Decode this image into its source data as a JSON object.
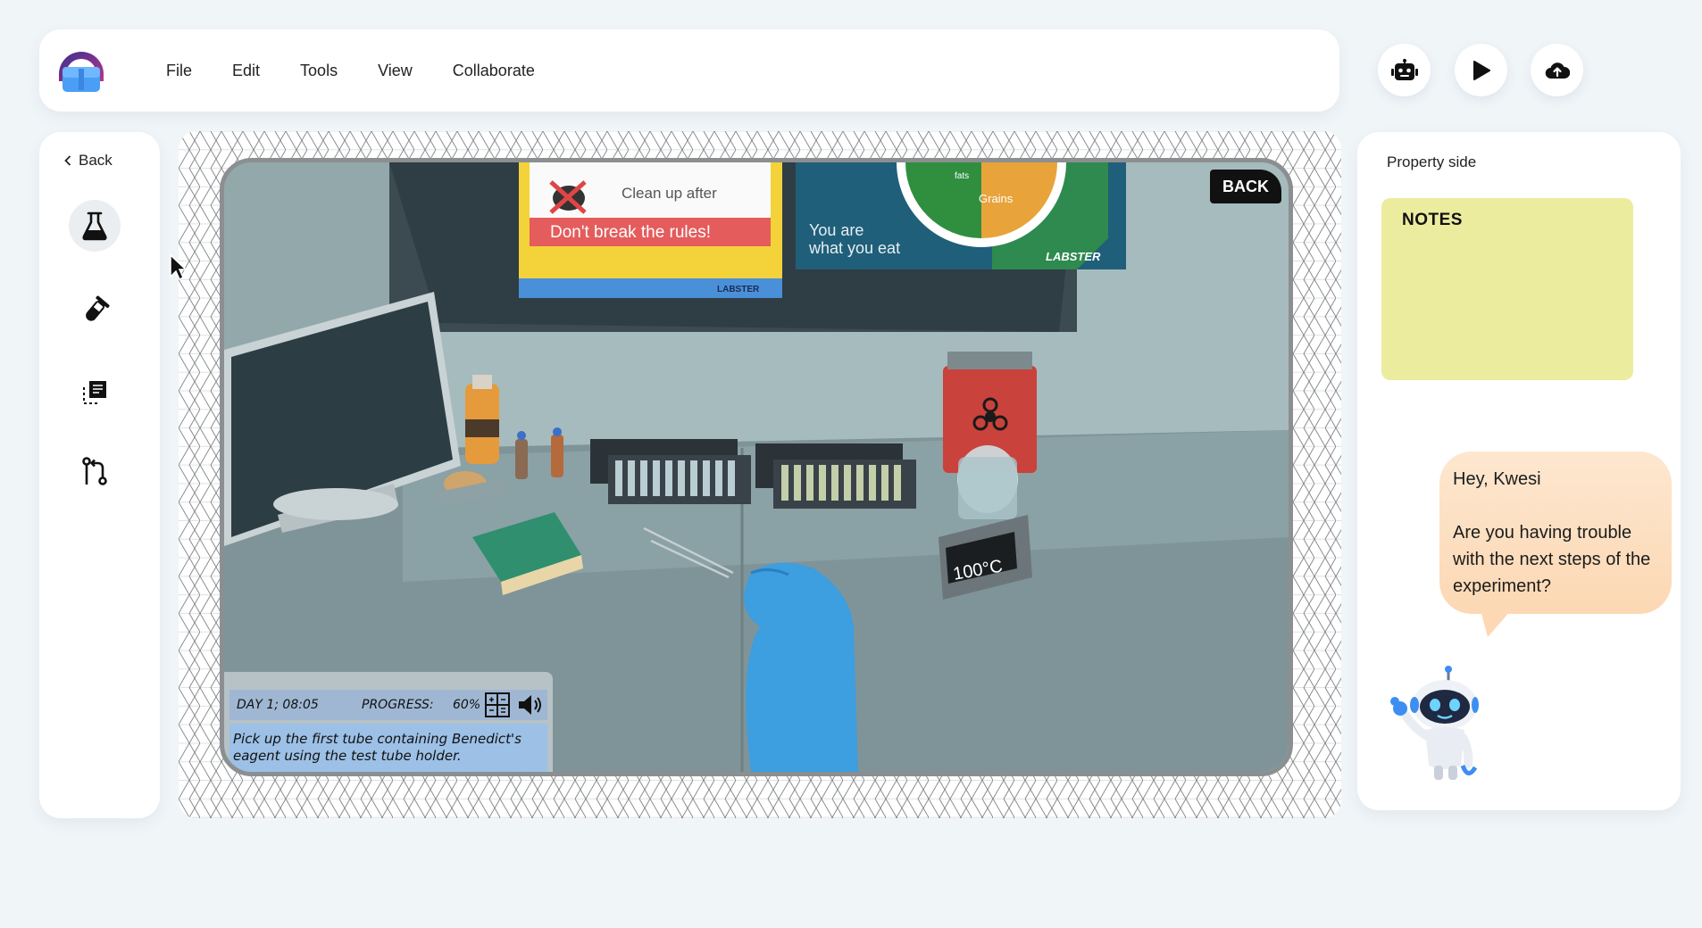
{
  "menubar": {
    "items": [
      "File",
      "Edit",
      "Tools",
      "View",
      "Collaborate"
    ]
  },
  "actions": {
    "assistant_icon": "robot-icon",
    "play_icon": "play-icon",
    "upload_icon": "cloud-upload-icon"
  },
  "sidebar": {
    "back_label": "Back",
    "tools": [
      {
        "icon": "flask-icon",
        "active": true
      },
      {
        "icon": "test-tube-icon",
        "active": false
      },
      {
        "icon": "select-area-icon",
        "active": false
      },
      {
        "icon": "branch-icon",
        "active": false
      }
    ]
  },
  "simulation": {
    "poster_rules_line1": "Clean up after",
    "poster_rules_line2": "Don't break the rules!",
    "poster_brand": "LABSTER",
    "poster_food_line1": "You are",
    "poster_food_line2": "what you eat",
    "poster_food_segment": "Grains",
    "poster_food_segment2": "fats",
    "poster_food_brand": "LABSTER",
    "back_button": "BACK",
    "hotplate_temp": "100°C",
    "hud": {
      "day": "DAY 1; 08:05",
      "progress_label": "PROGRESS:",
      "progress_value": "60%",
      "instruction": "Pick up the first tube containing Benedict's eagent using the test tube holder."
    }
  },
  "property": {
    "title": "Property side",
    "notes_title": "NOTES",
    "bubble_greeting": "Hey, Kwesi",
    "bubble_message": "Are you having trouble with the next steps of the experiment?"
  },
  "colors": {
    "background": "#f0f5f8",
    "notes": "#ecec9f",
    "bubble": "#fcd8b4",
    "accent_blue": "#3d8ef0"
  }
}
